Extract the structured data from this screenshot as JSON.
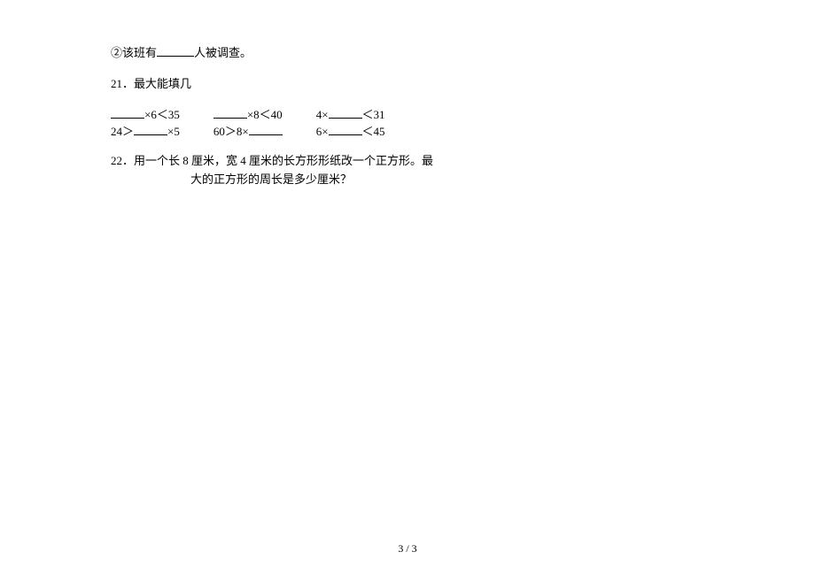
{
  "q20b": {
    "prefix": "②该班有",
    "suffix": "人被调查。"
  },
  "q21": {
    "label": "21．最大能填几",
    "row1": {
      "c1_suffix": "×6＜35",
      "c2_suffix": "×8＜40",
      "c3_prefix": "4×",
      "c3_suffix": "＜31"
    },
    "row2": {
      "c1_prefix": "24＞",
      "c1_suffix": "×5",
      "c2_prefix": "60＞8×",
      "c3_prefix": "6×",
      "c3_suffix": "＜45"
    }
  },
  "q22": {
    "label": "22．",
    "line1": "用一个长 8 厘米，宽 4 厘米的长方形形纸改一个正方形。最",
    "line2": "大的正方形的周长是多少厘米？"
  },
  "footer": "3 / 3"
}
